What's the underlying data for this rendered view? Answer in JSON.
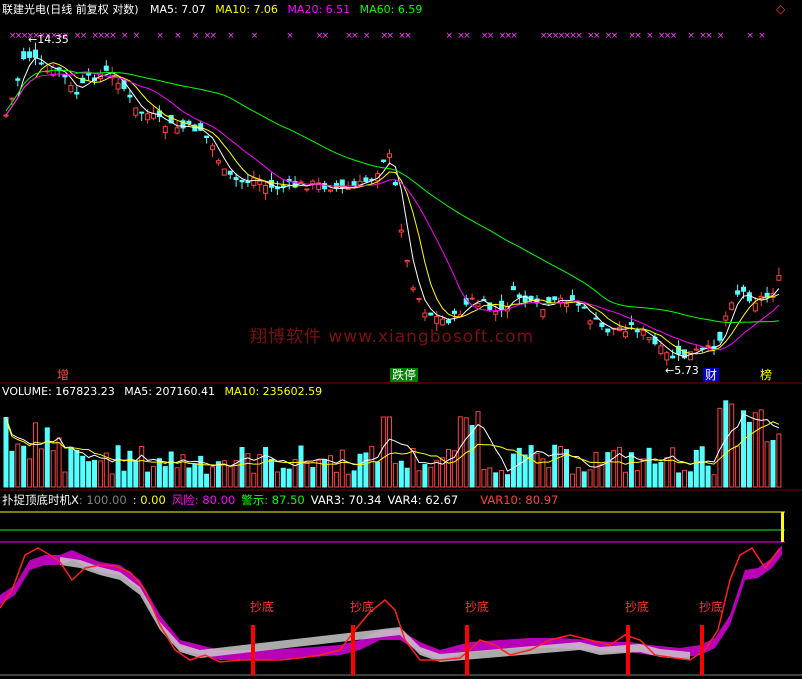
{
  "main": {
    "stock": "联建光电",
    "period": "(日线 前复权 对数)",
    "ma": [
      {
        "label": "MA5: ",
        "value": "7.07",
        "color": "#ffffff"
      },
      {
        "label": "MA10: ",
        "value": "7.06",
        "color": "#ffff00"
      },
      {
        "label": "MA20: ",
        "value": "6.51",
        "color": "#ff00ff"
      },
      {
        "label": "MA60: ",
        "value": "6.59",
        "color": "#00ff00"
      }
    ],
    "high_label": "14.35",
    "low_label": "5.73",
    "watermark": "翔博软件 www.xiangbosoft.com",
    "events": [
      {
        "text": "增",
        "color": "#ff4040",
        "bg": "transparent"
      },
      {
        "text": "跌停",
        "color": "#ffffff",
        "bg": "#008000"
      },
      {
        "text": "财",
        "color": "#ffffff",
        "bg": "#0000c0"
      },
      {
        "text": "榜",
        "color": "#ffff00",
        "bg": "transparent"
      }
    ]
  },
  "volume": {
    "label": "VOLUME: 167823.23",
    "ma5": "MA5: 207160.41",
    "ma10": "MA10: 235602.59"
  },
  "indicator": {
    "name": "扑捉顶底时机X",
    "items": [
      {
        "text": ": 100.00",
        "color": "#808080"
      },
      {
        "text": ": 0.00",
        "color": "#ffff00"
      },
      {
        "text": "风险: 80.00",
        "color": "#ff00ff"
      },
      {
        "text": "警示: 87.50",
        "color": "#00ff00"
      },
      {
        "text": "VAR3: 70.34",
        "color": "#ffffff"
      },
      {
        "text": "VAR4: 62.67",
        "color": "#ffffff"
      },
      {
        "text": "VAR10: 80.97",
        "color": "#ff4040"
      }
    ],
    "signal_label": "抄底"
  },
  "chart_data": {
    "type": "candlestick",
    "title": "联建光电(日线 前复权 对数)",
    "price_range": [
      5.73,
      14.35
    ],
    "ma_latest": {
      "MA5": 7.07,
      "MA10": 7.06,
      "MA20": 6.51,
      "MA60": 6.59
    },
    "volume_latest": {
      "VOLUME": 167823.23,
      "MA5": 207160.41,
      "MA10": 235602.59
    },
    "indicator_latest": {
      "风险": 80.0,
      "警示": 87.5,
      "VAR3": 70.34,
      "VAR4": 62.67,
      "VAR10": 80.97
    },
    "bottom_signals": 5,
    "grid": false
  }
}
